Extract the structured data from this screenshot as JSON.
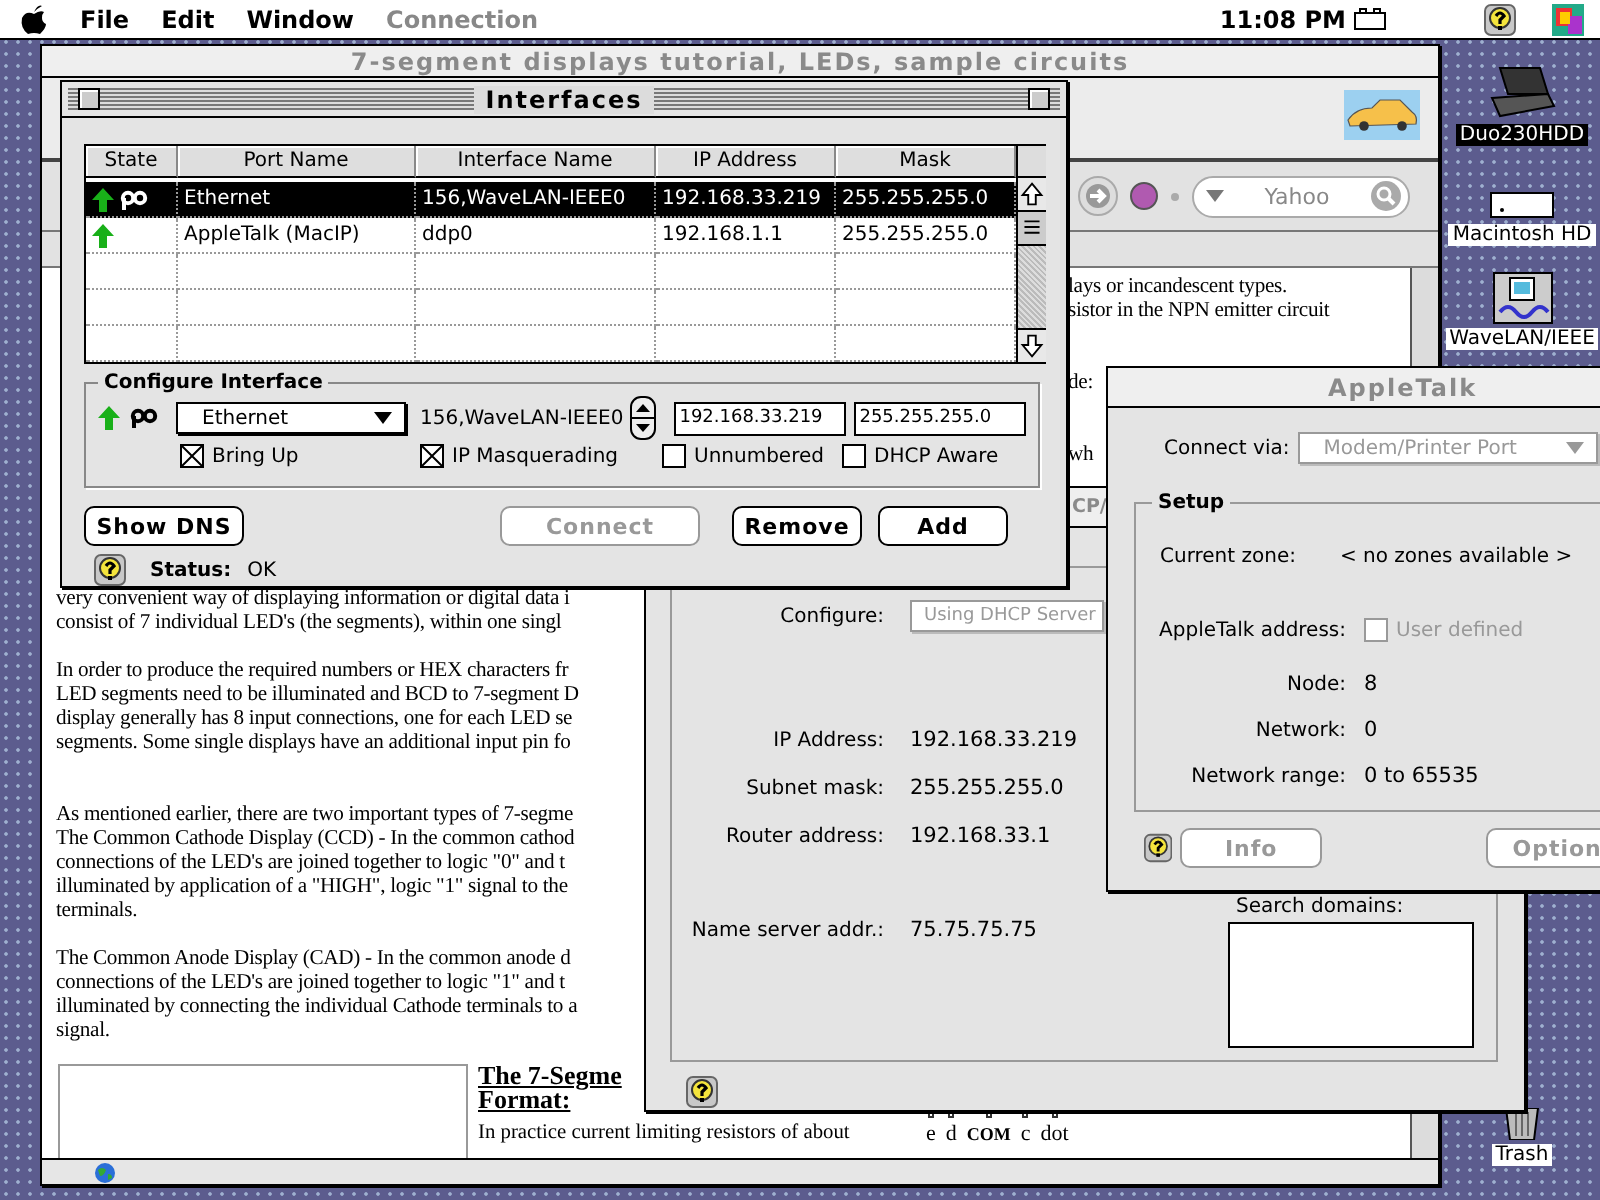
{
  "menu_bar": {
    "items": [
      {
        "label": "File",
        "disabled": false
      },
      {
        "label": "Edit",
        "disabled": false
      },
      {
        "label": "Window",
        "disabled": false
      },
      {
        "label": "Connection",
        "disabled": true
      }
    ],
    "clock": "11:08 PM"
  },
  "desktop_icons": [
    {
      "label": "Duo230HDD",
      "kind": "laptop",
      "selected": true
    },
    {
      "label": "Macintosh HD",
      "kind": "disk",
      "selected": false
    },
    {
      "label": "WaveLAN/IEEE",
      "kind": "card",
      "selected": false
    },
    {
      "label": "Trash",
      "kind": "trash",
      "selected": false
    }
  ],
  "browser": {
    "title": "7-segment displays tutorial, LEDs, sample circuits",
    "active": false,
    "search": {
      "placeholder": "Yahoo"
    },
    "lines": [
      {
        "kind": "text",
        "right": "lays or incandescent types."
      },
      {
        "kind": "text",
        "right": "sistor in the NPN emitter circuit"
      },
      {
        "kind": "blank"
      },
      {
        "kind": "blank"
      },
      {
        "kind": "text",
        "right": "de:"
      },
      {
        "kind": "blank"
      },
      {
        "kind": "blank"
      },
      {
        "kind": "text",
        "right": "wh"
      },
      {
        "kind": "blank"
      },
      {
        "kind": "blank"
      },
      {
        "kind": "blank"
      },
      {
        "kind": "blank"
      },
      {
        "kind": "blank"
      },
      {
        "kind": "text",
        "left": "very convenient way of displaying information or digital data i"
      },
      {
        "kind": "text",
        "left": "consist of 7 individual LED's (the segments), within one singl"
      },
      {
        "kind": "blank"
      },
      {
        "kind": "text",
        "left": "In order to produce the required numbers or HEX characters fr"
      },
      {
        "kind": "text",
        "left": "LED segments need to be illuminated and BCD to 7-segment D"
      },
      {
        "kind": "text",
        "left": "display generally has 8 input connections, one for each LED se"
      },
      {
        "kind": "text",
        "left": "segments.  Some single displays have an additional input pin fo"
      },
      {
        "kind": "blank"
      },
      {
        "kind": "blank"
      },
      {
        "kind": "text",
        "left": "As mentioned earlier, there are two important types of 7-segme"
      },
      {
        "kind": "text",
        "left": "The Common Cathode Display (CCD) - In the common cathod"
      },
      {
        "kind": "text",
        "left": "connections of the LED's are joined together to logic \"0\" and t"
      },
      {
        "kind": "text",
        "left": "illuminated by application of a \"HIGH\", logic \"1\" signal to the"
      },
      {
        "kind": "text",
        "left": "terminals."
      },
      {
        "kind": "blank"
      },
      {
        "kind": "text",
        "left": "The Common Anode Display (CAD) - In the common anode d"
      },
      {
        "kind": "text",
        "left": "connections of the LED's are joined together to logic \"1\" and t"
      },
      {
        "kind": "text",
        "left": "illuminated by connecting the individual Cathode terminals to a"
      },
      {
        "kind": "text",
        "left": "signal."
      }
    ],
    "figure": {
      "heading": [
        "The 7-Segme",
        "Format:"
      ],
      "text": [
        "In practice current limiting resistors of about"
      ],
      "pins": [
        "e",
        "d",
        "COM",
        "c",
        "dot"
      ]
    }
  },
  "tcpip": {
    "title": "CP/",
    "active": false,
    "configure": {
      "label": "Configure:",
      "value": "Using DHCP Server",
      "disabled": true
    },
    "fields": [
      {
        "label": "IP Address:",
        "value": "192.168.33.219"
      },
      {
        "label": "Subnet mask:",
        "value": "255.255.255.0"
      },
      {
        "label": "Router address:",
        "value": "192.168.33.1"
      },
      {
        "label": "Name server addr.:",
        "value": "75.75.75.75"
      }
    ],
    "search_domains_label": "Search domains:"
  },
  "appletalk": {
    "title": "AppleTalk",
    "active": false,
    "connect_via": {
      "label": "Connect via:",
      "value": "Modem/Printer Port",
      "disabled": true
    },
    "setup": {
      "legend": "Setup",
      "zone_label": "Current zone:",
      "zone_value": "< no zones available >",
      "address": {
        "label": "AppleTalk address:",
        "checkbox": "User defined",
        "checked": false,
        "disabled": true
      },
      "rows": [
        {
          "label": "Node:",
          "value": "8"
        },
        {
          "label": "Network:",
          "value": "0"
        },
        {
          "label": "Network range:",
          "value": "0 to 65535"
        }
      ]
    },
    "buttons": [
      {
        "label": "Info",
        "disabled": true
      },
      {
        "label": "Option",
        "disabled": true
      }
    ]
  },
  "interfaces": {
    "title": "Interfaces",
    "active": true,
    "columns": [
      "State",
      "Port Name",
      "Interface Name",
      "IP Address",
      "Mask"
    ],
    "rows": [
      {
        "up": true,
        "connected": true,
        "port": "Ethernet",
        "interface": "156,WaveLAN-IEEE0",
        "ip": "192.168.33.219",
        "mask": "255.255.255.0",
        "selected": true
      },
      {
        "up": true,
        "connected": false,
        "port": "AppleTalk (MacIP)",
        "interface": "ddp0",
        "ip": "192.168.1.1",
        "mask": "255.255.255.0",
        "selected": false
      }
    ],
    "configure": {
      "legend": "Configure Interface",
      "up": true,
      "connected": true,
      "port": "Ethernet",
      "interface": "156,WaveLAN-IEEE0",
      "ip": "192.168.33.219",
      "mask": "255.255.255.0",
      "options": [
        {
          "label": "Bring Up",
          "checked": true
        },
        {
          "label": "IP Masquerading",
          "checked": true
        },
        {
          "label": "Unnumbered",
          "checked": false
        },
        {
          "label": "DHCP Aware",
          "checked": false
        }
      ]
    },
    "buttons": [
      {
        "label": "Show DNS",
        "disabled": false
      },
      {
        "label": "Connect",
        "disabled": true
      },
      {
        "label": "Remove",
        "disabled": false
      },
      {
        "label": "Add",
        "disabled": false
      }
    ],
    "status": {
      "label": "Status:",
      "value": "OK"
    }
  }
}
